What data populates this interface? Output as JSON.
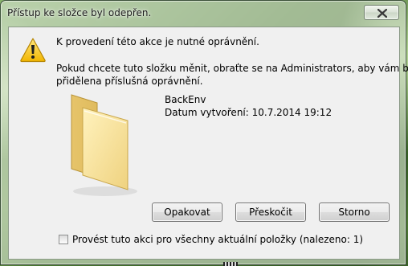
{
  "window": {
    "title": "Přístup ke složce byl odepřen."
  },
  "message": {
    "heading": "K provedení této akce je nutné oprávnění.",
    "body_line1": "Pokud chcete tuto složku měnit, obraťte se na Administrators, aby vám byla",
    "body_line2": "přidělena příslušná oprávnění."
  },
  "folder": {
    "name": "BackEnv",
    "created": "Datum vytvoření: 10.7.2014 19:12"
  },
  "buttons": {
    "retry": "Opakovat",
    "skip": "Přeskočit",
    "cancel": "Storno"
  },
  "checkbox": {
    "label": "Provést tuto akci pro všechny aktuální položky (nalezeno: 1)",
    "checked": false
  },
  "icons": {
    "warning": "warning-icon",
    "folder": "folder-icon",
    "close": "close-icon"
  }
}
